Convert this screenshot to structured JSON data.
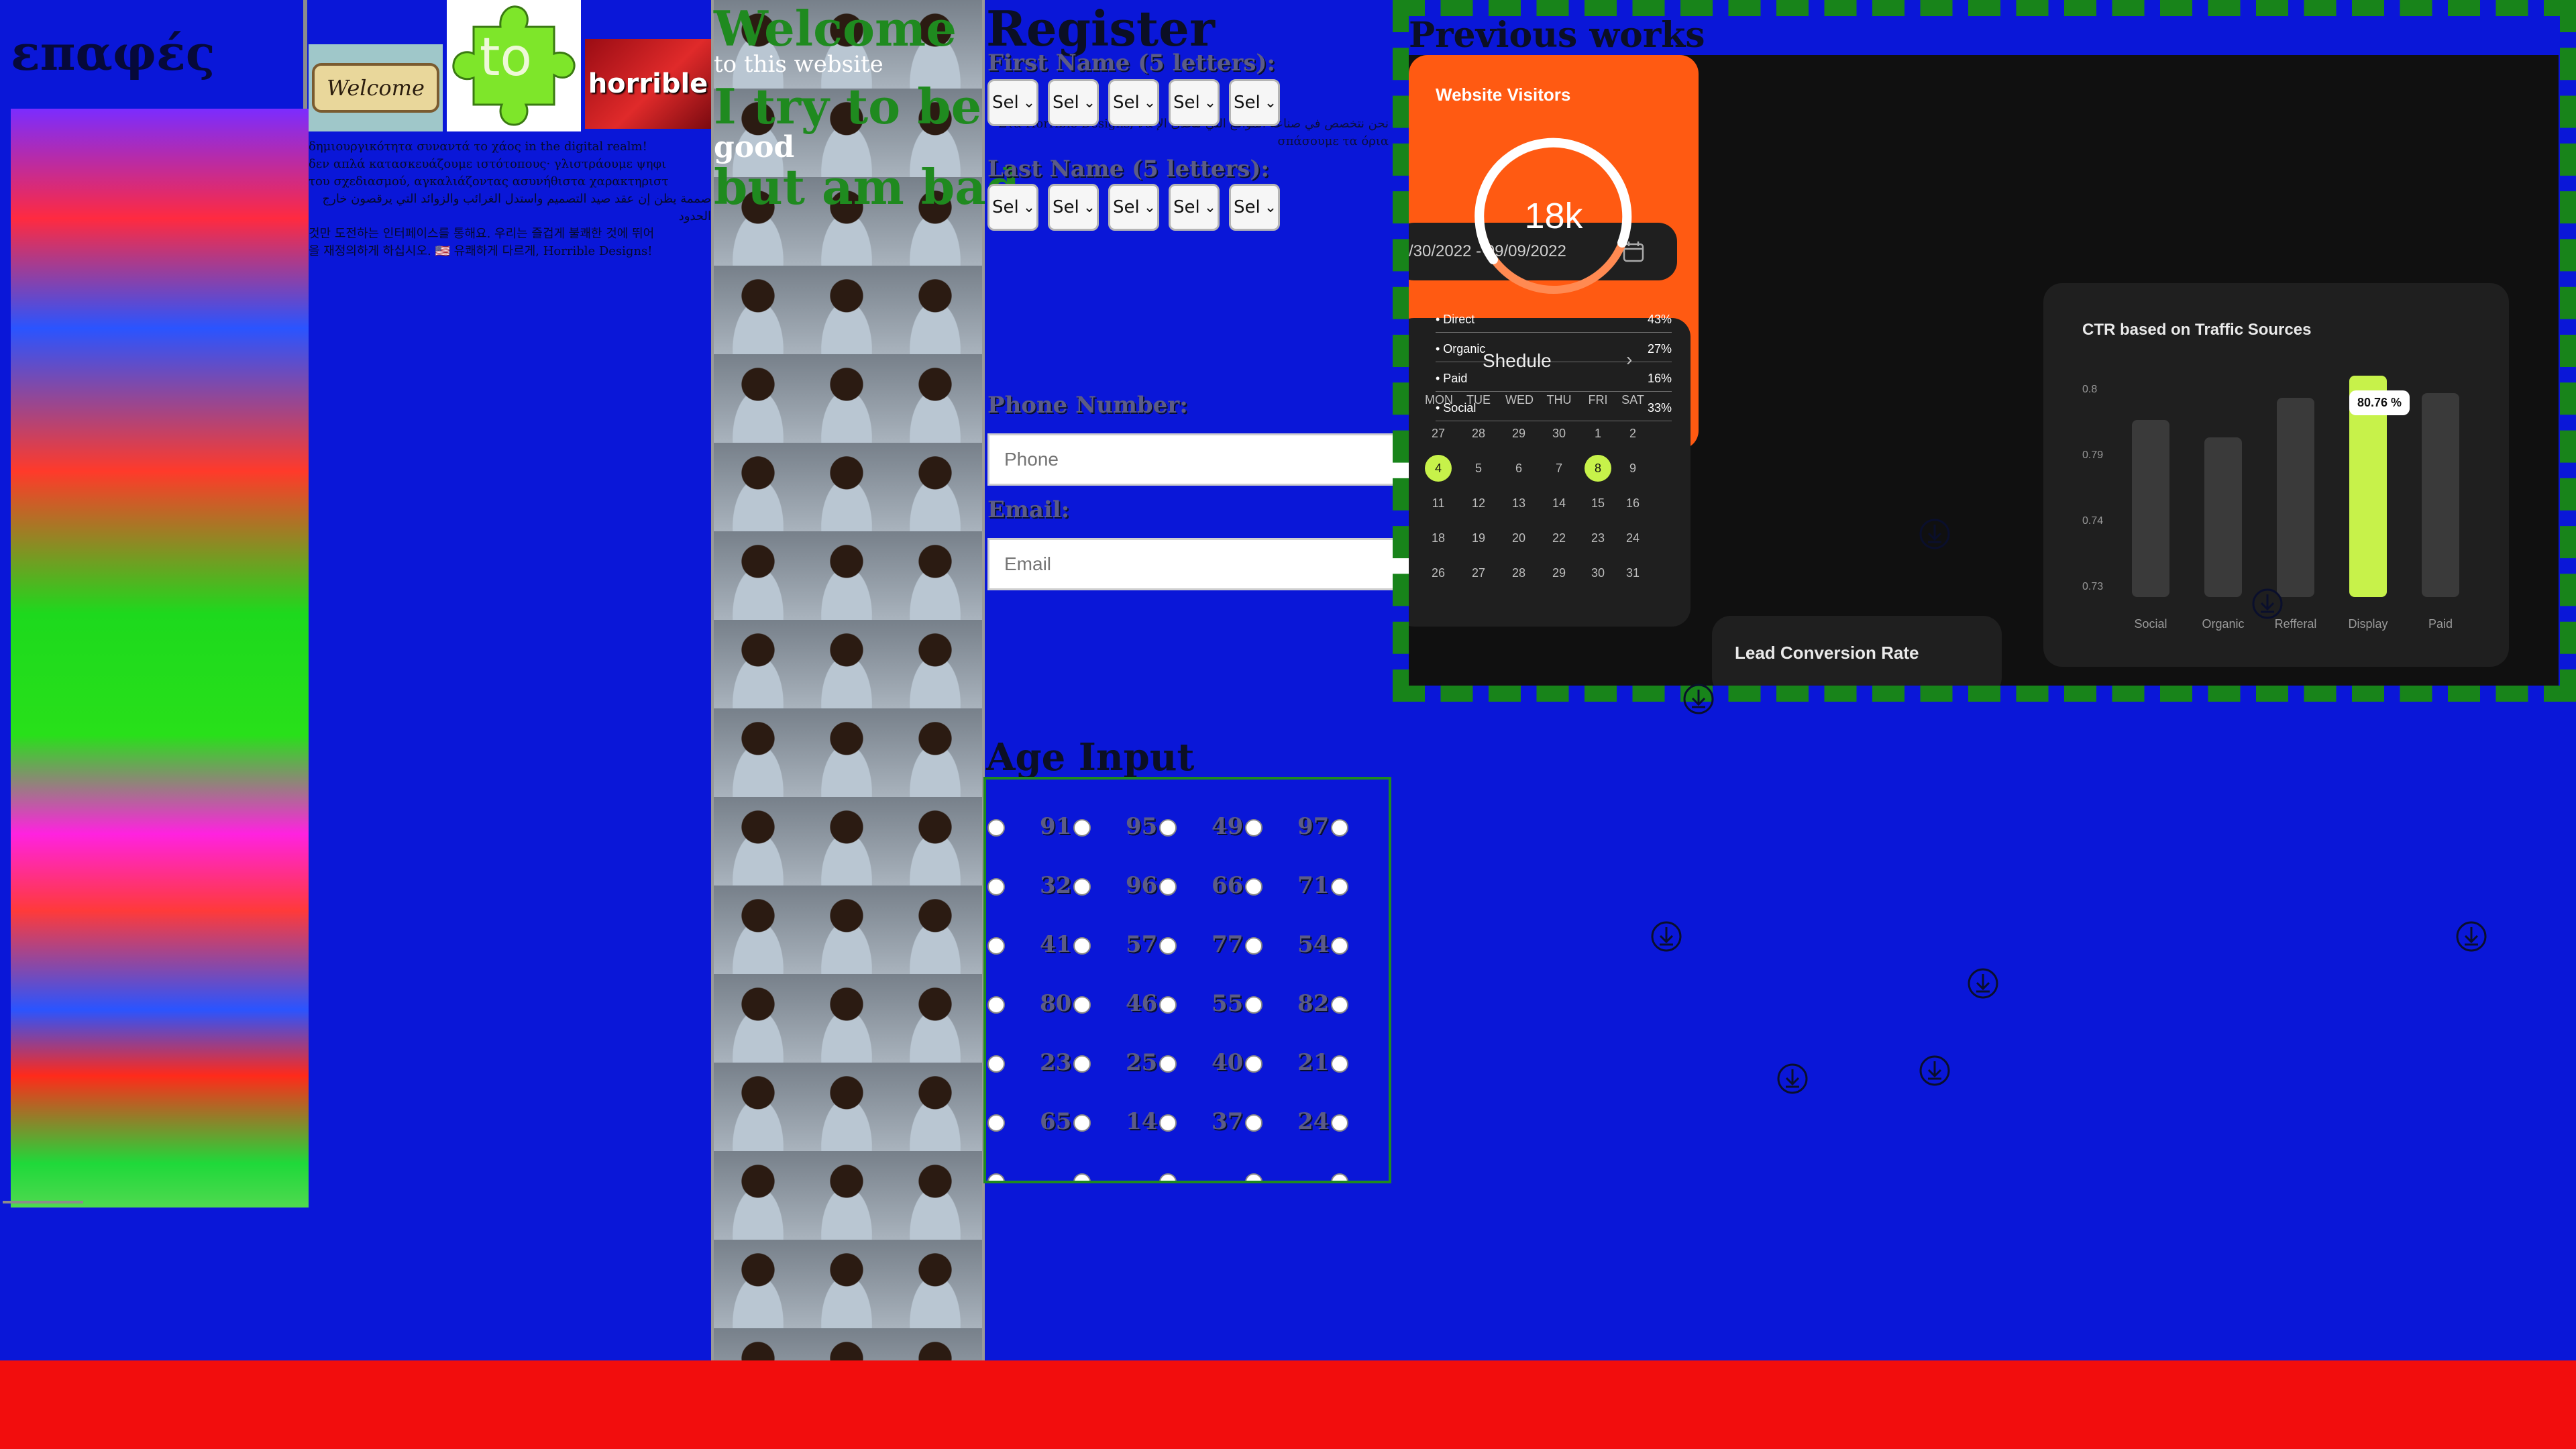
{
  "sidebar": {
    "title": "επαφές"
  },
  "logos": {
    "welcome": "Welcome",
    "to": "to",
    "horrible": "horrible"
  },
  "intro": {
    "line1": "δημιουργικότητα συναντά το χάος in the digital realm!",
    "line2": "δεν απλά κατασκευάζουμε ιστότοπους· γλιστράουμε ψηφι",
    "line3": "του σχεδιασμού, αγκαλιάζοντας ασυνήθιστα χαρακτηριστ",
    "line4": "صممة يظن إن عقد صيد التصميم واستدل الغرائب والزوائد التي يرقصون خارج الحدود",
    "line5": "것만 도전하는 인터페이스를 통해요. 우리는 즐겁게 불쾌한 것에 뛰어",
    "line6": "을 재정의하게 하십시오. 🇺🇸 유쾌하게 다르게, Horrible Designs!"
  },
  "hero": {
    "welcome": "Welcome",
    "sub": "to this website",
    "try": "I try to be",
    "good": "good",
    "bad": "but am bad"
  },
  "register": {
    "title": "Register",
    "first_name_label": "First Name (5 letters):",
    "last_name_label": "Last Name (5 letters):",
    "select_value": "Sel",
    "phone_label": "Phone Number:",
    "phone_placeholder": "Phone",
    "email_label": "Email:",
    "email_placeholder": "Email",
    "background_text": "نحن نتخصص في صناعة المواقع التي تتحدى الإ Στα Horrible Designs, να σπάσουμε τα όρια"
  },
  "age": {
    "title": "Age Input",
    "rows": [
      [
        "91",
        "95",
        "49",
        "97"
      ],
      [
        "32",
        "96",
        "66",
        "71"
      ],
      [
        "41",
        "57",
        "77",
        "54"
      ],
      [
        "80",
        "46",
        "55",
        "82"
      ],
      [
        "23",
        "25",
        "40",
        "21"
      ],
      [
        "65",
        "14",
        "37",
        "24"
      ]
    ]
  },
  "works": {
    "title": "Previous works",
    "date_range": "/30/2022 - 09/09/2022",
    "schedule_title": "Shedule",
    "weekdays": [
      "MON",
      "TUE",
      "WED",
      "THU",
      "FRI",
      "SAT"
    ],
    "cal_rows": [
      [
        "27",
        "28",
        "29",
        "30",
        "1",
        "2"
      ],
      [
        "4",
        "5",
        "6",
        "7",
        "8",
        "9"
      ],
      [
        "11",
        "12",
        "13",
        "14",
        "15",
        "16"
      ],
      [
        "18",
        "19",
        "20",
        "22",
        "23",
        "24"
      ],
      [
        "26",
        "27",
        "28",
        "29",
        "30",
        "31"
      ]
    ],
    "visitors_title": "Website Visitors",
    "visitors_value": "18k",
    "sources": [
      {
        "label": "Direct",
        "value": "43%"
      },
      {
        "label": "Organic",
        "value": "27%"
      },
      {
        "label": "Paid",
        "value": "16%"
      },
      {
        "label": "Social",
        "value": "33%"
      }
    ],
    "ctr_title": "CTR based on Traffic Sources",
    "ctr_ticks": [
      "0.8",
      "0.79",
      "0.74",
      "0.73"
    ],
    "ctr_categories": [
      "Social",
      "Organic",
      "Refferal",
      "Display",
      "Paid"
    ],
    "ctr_bar_heights": [
      0.8,
      0.72,
      0.9,
      1.0,
      0.92
    ],
    "ctr_tooltip": "80.76 %",
    "lead_title": "Lead Conversion Rate"
  },
  "colors": {
    "background": "#0a17d8",
    "footer": "#f20d0d",
    "accent_green": "#1f8a1f",
    "orange": "#ff5a12",
    "lime": "#c7f24a"
  }
}
